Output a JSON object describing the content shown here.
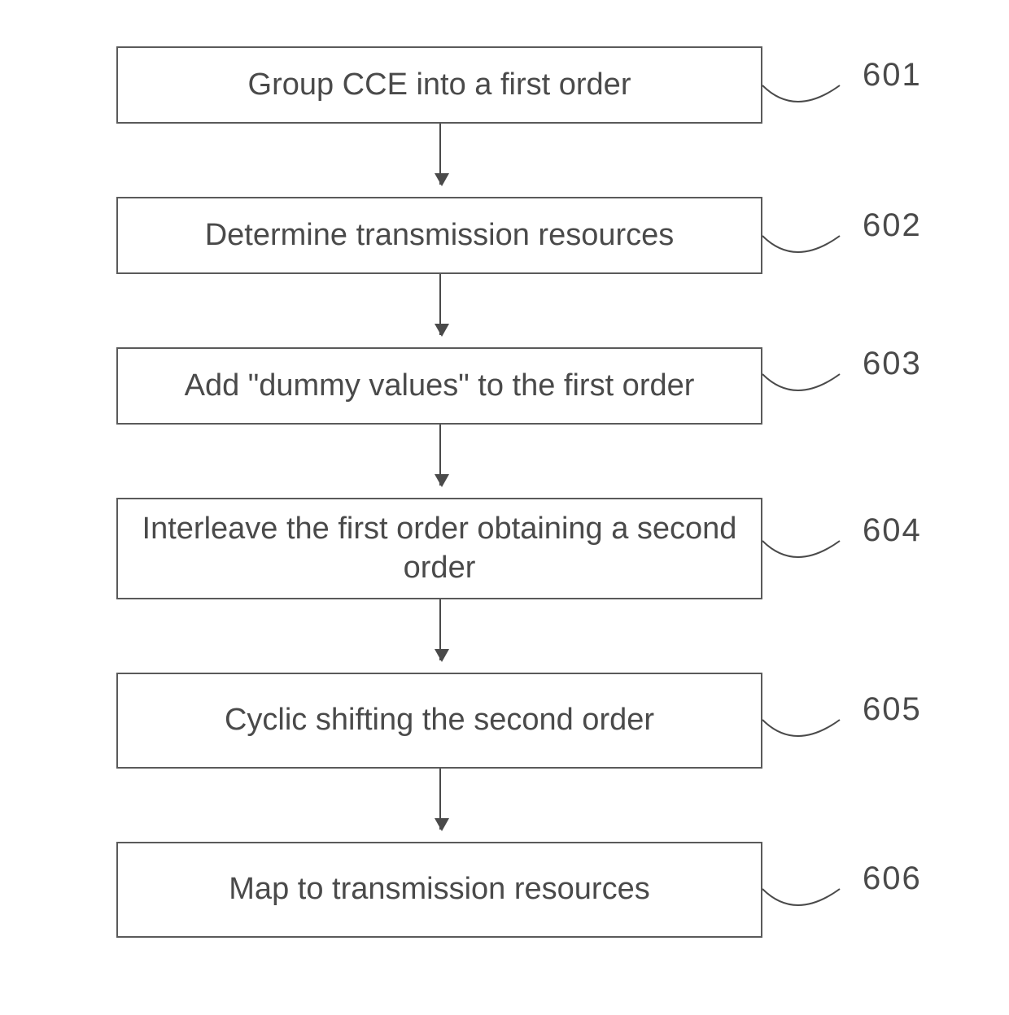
{
  "steps": [
    {
      "label": "Group CCE into a first order",
      "ref": "601"
    },
    {
      "label": "Determine  transmission resources",
      "ref": "602"
    },
    {
      "label": "Add \"dummy values\" to the first order",
      "ref": "603"
    },
    {
      "label": "Interleave the first order obtaining a second order",
      "ref": "604"
    },
    {
      "label": "Cyclic shifting the second order",
      "ref": "605"
    },
    {
      "label": "Map to transmission resources",
      "ref": "606"
    }
  ]
}
